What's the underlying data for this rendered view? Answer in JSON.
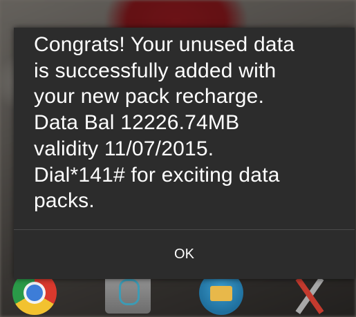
{
  "dialog": {
    "message": "Congrats! Your unused data\nis successfully added with\nyour new pack recharge.\nData Bal 12226.74MB\nvalidity 11/07/2015.\nDial*141# for exciting data\npacks.",
    "ok_label": "OK"
  },
  "dock": {
    "icons": [
      "chrome-icon",
      "phone-icon",
      "messaging-icon",
      "tools-icon"
    ]
  },
  "colors": {
    "dialog_background": "#2c2c2c",
    "text": "#ffffff",
    "divider": "#4a4a4a"
  }
}
